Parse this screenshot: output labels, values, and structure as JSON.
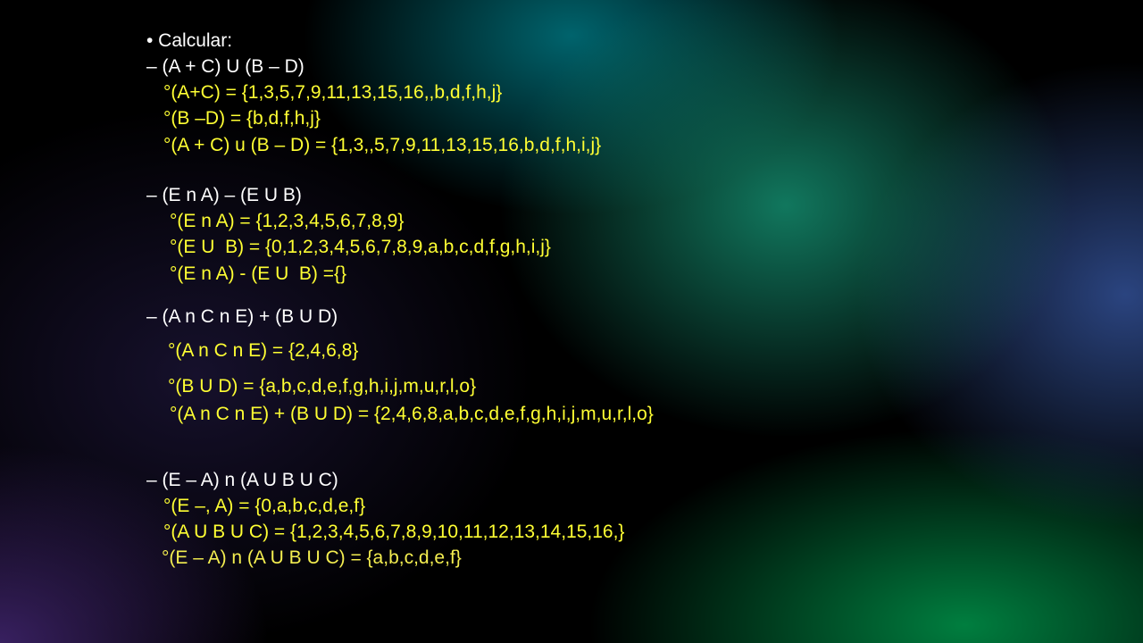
{
  "slide": {
    "heading": "• Calcular:",
    "sections": [
      {
        "title": "– (A + C) U (B – D)",
        "lines": [
          "°(A+C) = {1,3,5,7,9,11,13,15,16,,b,d,f,h,j}",
          "°(B –D) = {b,d,f,h,j}",
          "°(A + C) u (B – D) = {1,3,,5,7,9,11,13,15,16,b,d,f,h,i,j}"
        ]
      },
      {
        "title": "– (E n A) – (E U B)",
        "lines": [
          "°(E n A) = {1,2,3,4,5,6,7,8,9}",
          "°(E U  B) = {0,1,2,3,4,5,6,7,8,9,a,b,c,d,f,g,h,i,j}",
          "°(E n A) - (E U  B) ={}"
        ]
      },
      {
        "title": "– (A n C n E) + (B U D)",
        "lines": [
          "°(A n C n E) = {2,4,6,8}",
          "°(B U D) = {a,b,c,d,e,f,g,h,i,j,m,u,r,l,o}",
          "°(A n C n E) + (B U D) = {2,4,6,8,a,b,c,d,e,f,g,h,i,j,m,u,r,l,o}"
        ]
      },
      {
        "title": "– (E – A) n (A U B U C)",
        "lines": [
          "°(E –, A) = {0,a,b,c,d,e,f}",
          "°(A U B U C) = {1,2,3,4,5,6,7,8,9,10,11,12,13,14,15,16,}",
          "°(E – A) n (A U B U C) = {a,b,c,d,e,f}"
        ]
      }
    ],
    "colors": {
      "heading_text": "#ffffff",
      "result_text": "#ffff33",
      "result_text_last": "#f4ee50"
    }
  }
}
